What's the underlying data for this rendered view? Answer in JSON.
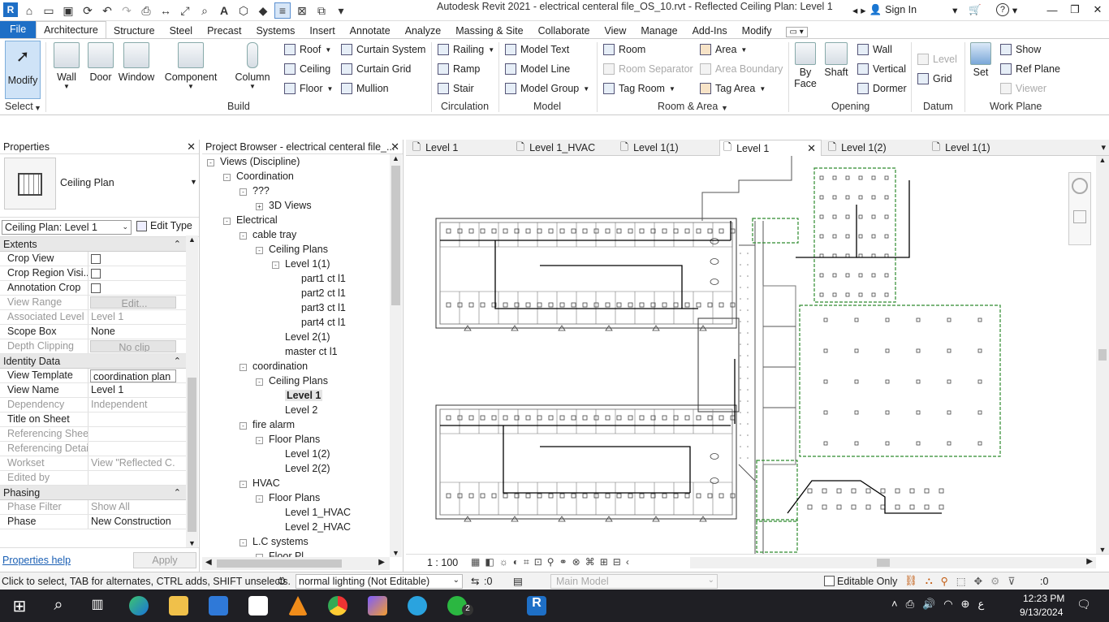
{
  "window": {
    "title": "Autodesk Revit 2021 - electrical centeral file_OS_10.rvt - Reflected Ceiling Plan: Level 1",
    "sign_in": "Sign In"
  },
  "ribbon_tabs": [
    "File",
    "Architecture",
    "Structure",
    "Steel",
    "Precast",
    "Systems",
    "Insert",
    "Annotate",
    "Analyze",
    "Massing & Site",
    "Collaborate",
    "View",
    "Manage",
    "Add-Ins",
    "Modify"
  ],
  "ribbon": {
    "select": {
      "modify": "Modify",
      "panel": "Select"
    },
    "build": {
      "wall": "Wall",
      "door": "Door",
      "window": "Window",
      "component": "Component",
      "column": "Column",
      "roof": "Roof",
      "ceiling": "Ceiling",
      "floor": "Floor",
      "curtain_system": "Curtain System",
      "curtain_grid": "Curtain Grid",
      "mullion": "Mullion",
      "panel": "Build"
    },
    "circulation": {
      "railing": "Railing",
      "ramp": "Ramp",
      "stair": "Stair",
      "panel": "Circulation"
    },
    "model": {
      "model_text": "Model Text",
      "model_line": "Model Line",
      "model_group": "Model Group",
      "panel": "Model"
    },
    "room_area": {
      "room": "Room",
      "room_separator": "Room Separator",
      "tag_room": "Tag Room",
      "area": "Area",
      "area_boundary": "Area Boundary",
      "tag_area": "Tag Area",
      "panel": "Room & Area"
    },
    "opening": {
      "by_face_1": "By",
      "by_face_2": "Face",
      "shaft": "Shaft",
      "wall": "Wall",
      "vertical": "Vertical",
      "dormer": "Dormer",
      "panel": "Opening"
    },
    "datum": {
      "level": "Level",
      "grid": "Grid",
      "panel": "Datum"
    },
    "work_plane": {
      "set": "Set",
      "show": "Show",
      "ref_plane": "Ref Plane",
      "viewer": "Viewer",
      "panel": "Work Plane"
    }
  },
  "properties": {
    "title": "Properties",
    "type_name": "Ceiling Plan",
    "instance_select": "Ceiling Plan: Level 1",
    "edit_type": "Edit Type",
    "groups": [
      {
        "name": "Extents",
        "rows": [
          {
            "k": "Crop View",
            "v": "",
            "cb": true,
            "dis": false
          },
          {
            "k": "Crop Region Visi...",
            "v": "",
            "cb": true,
            "dis": false
          },
          {
            "k": "Annotation Crop",
            "v": "",
            "cb": true,
            "dis": false
          },
          {
            "k": "View Range",
            "v": "Edit...",
            "btn": true,
            "dis": true
          },
          {
            "k": "Associated Level",
            "v": "Level 1",
            "dis": true
          },
          {
            "k": "Scope Box",
            "v": "None",
            "dis": false
          },
          {
            "k": "Depth Clipping",
            "v": "No clip",
            "btn": true,
            "dis": true
          }
        ]
      },
      {
        "name": "Identity Data",
        "rows": [
          {
            "k": "View Template",
            "v": "coordination plan",
            "boxed": true,
            "dis": false
          },
          {
            "k": "View Name",
            "v": "Level 1",
            "dis": false
          },
          {
            "k": "Dependency",
            "v": "Independent",
            "dis": true
          },
          {
            "k": "Title on Sheet",
            "v": "",
            "dis": false
          },
          {
            "k": "Referencing Sheet",
            "v": "",
            "dis": true
          },
          {
            "k": "Referencing Detail",
            "v": "",
            "dis": true
          },
          {
            "k": "Workset",
            "v": "View \"Reflected C...",
            "dis": true
          },
          {
            "k": "Edited by",
            "v": "",
            "dis": true
          }
        ]
      },
      {
        "name": "Phasing",
        "rows": [
          {
            "k": "Phase Filter",
            "v": "Show All",
            "dis": true
          },
          {
            "k": "Phase",
            "v": "New Construction",
            "dis": false
          }
        ]
      }
    ],
    "help": "Properties help",
    "apply": "Apply"
  },
  "browser": {
    "title": "Project Browser - electrical centeral file_...",
    "nodes": [
      {
        "label": "Views (Discipline)",
        "lvl": 0,
        "tog": "-"
      },
      {
        "label": "Coordination",
        "lvl": 1,
        "tog": "-"
      },
      {
        "label": "???",
        "lvl": 2,
        "tog": "-"
      },
      {
        "label": "3D Views",
        "lvl": 3,
        "tog": "+"
      },
      {
        "label": "Electrical",
        "lvl": 1,
        "tog": "-"
      },
      {
        "label": "cable tray",
        "lvl": 2,
        "tog": "-"
      },
      {
        "label": "Ceiling Plans",
        "lvl": 3,
        "tog": "-"
      },
      {
        "label": "Level 1(1)",
        "lvl": 4,
        "tog": "-"
      },
      {
        "label": "part1 ct l1",
        "lvl": 5,
        "tog": ""
      },
      {
        "label": "part2 ct l1",
        "lvl": 5,
        "tog": ""
      },
      {
        "label": "part3 ct l1",
        "lvl": 5,
        "tog": ""
      },
      {
        "label": "part4 ct l1",
        "lvl": 5,
        "tog": ""
      },
      {
        "label": "Level 2(1)",
        "lvl": 4,
        "tog": ""
      },
      {
        "label": "master ct l1",
        "lvl": 4,
        "tog": ""
      },
      {
        "label": "coordination",
        "lvl": 2,
        "tog": "-"
      },
      {
        "label": "Ceiling Plans",
        "lvl": 3,
        "tog": "-"
      },
      {
        "label": "Level 1",
        "lvl": 4,
        "tog": "",
        "bold": true
      },
      {
        "label": "Level 2",
        "lvl": 4,
        "tog": ""
      },
      {
        "label": "fire alarm",
        "lvl": 2,
        "tog": "-"
      },
      {
        "label": "Floor Plans",
        "lvl": 3,
        "tog": "-"
      },
      {
        "label": "Level 1(2)",
        "lvl": 4,
        "tog": ""
      },
      {
        "label": "Level 2(2)",
        "lvl": 4,
        "tog": ""
      },
      {
        "label": "HVAC",
        "lvl": 2,
        "tog": "-"
      },
      {
        "label": "Floor Plans",
        "lvl": 3,
        "tog": "-"
      },
      {
        "label": "Level 1_HVAC",
        "lvl": 4,
        "tog": ""
      },
      {
        "label": "Level 2_HVAC",
        "lvl": 4,
        "tog": ""
      },
      {
        "label": "L.C systems",
        "lvl": 2,
        "tog": "-"
      },
      {
        "label": "Floor Pl...",
        "lvl": 3,
        "tog": "-"
      }
    ]
  },
  "view_tabs": [
    "Level 1",
    "Level 1_HVAC",
    "Level 1(1)",
    "Level 1",
    "Level 1(2)",
    "Level 1(1)"
  ],
  "view_control": {
    "scale": "1 : 100"
  },
  "status": {
    "hint": "Click to select, TAB for alternates, CTRL adds, SHIFT unselects.",
    "lighting": "normal lighting (Not Editable)",
    "count": ":0",
    "model": "Main Model",
    "editable_only": "Editable Only",
    "filter_count": ":0"
  },
  "taskbar": {
    "time": "12:23 PM",
    "date": "9/13/2024",
    "lang": "ع",
    "badge": "2"
  }
}
